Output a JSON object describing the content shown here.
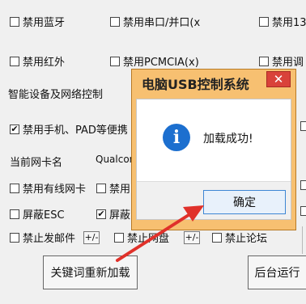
{
  "options": {
    "disable_bluetooth": "禁用蓝牙",
    "disable_serial_parallel": "禁用串口/并口(x",
    "disable_13": "禁用13",
    "disable_infrared": "禁用红外",
    "disable_pcmcia": "禁用PCMCIA(x)",
    "disable_adjust": "禁用调",
    "disable_phone_pad": "禁用手机、PAD等便携",
    "disable_wired_nic": "禁用有线网卡",
    "disable_partial": "禁用",
    "block_esc": "屏蔽ESC",
    "block_partial": "屏蔽",
    "block_email": "禁止发邮件",
    "block_partial2": "禁止网盘",
    "block_forum": "禁止论坛"
  },
  "section": {
    "smart_devices_title": "智能设备及网络控制",
    "current_nic_label": "当前网卡名",
    "current_nic_value": "Qualcom"
  },
  "buttons": {
    "plus_minus": "+/-",
    "reload_keywords": "关键词重新加载",
    "background_run": "后台运行"
  },
  "dialog": {
    "title": "电脑USB控制系统",
    "close_glyph": "✕",
    "message": "加载成功!",
    "ok_label": "确定",
    "info_glyph": "i"
  },
  "colors": {
    "dialog_frame": "#f7c071",
    "close_button": "#d9423a",
    "info_icon": "#1c6fcf",
    "arrow": "#e0312a"
  }
}
